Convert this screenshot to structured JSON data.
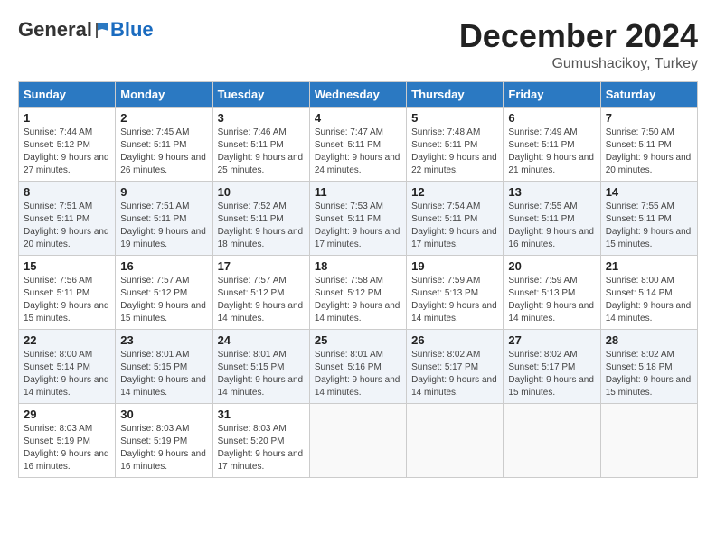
{
  "header": {
    "logo_general": "General",
    "logo_blue": "Blue",
    "month_title": "December 2024",
    "location": "Gumushacikoy, Turkey"
  },
  "weekdays": [
    "Sunday",
    "Monday",
    "Tuesday",
    "Wednesday",
    "Thursday",
    "Friday",
    "Saturday"
  ],
  "weeks": [
    [
      {
        "day": "1",
        "sunrise": "7:44 AM",
        "sunset": "5:12 PM",
        "daylight": "9 hours and 27 minutes."
      },
      {
        "day": "2",
        "sunrise": "7:45 AM",
        "sunset": "5:11 PM",
        "daylight": "9 hours and 26 minutes."
      },
      {
        "day": "3",
        "sunrise": "7:46 AM",
        "sunset": "5:11 PM",
        "daylight": "9 hours and 25 minutes."
      },
      {
        "day": "4",
        "sunrise": "7:47 AM",
        "sunset": "5:11 PM",
        "daylight": "9 hours and 24 minutes."
      },
      {
        "day": "5",
        "sunrise": "7:48 AM",
        "sunset": "5:11 PM",
        "daylight": "9 hours and 22 minutes."
      },
      {
        "day": "6",
        "sunrise": "7:49 AM",
        "sunset": "5:11 PM",
        "daylight": "9 hours and 21 minutes."
      },
      {
        "day": "7",
        "sunrise": "7:50 AM",
        "sunset": "5:11 PM",
        "daylight": "9 hours and 20 minutes."
      }
    ],
    [
      {
        "day": "8",
        "sunrise": "7:51 AM",
        "sunset": "5:11 PM",
        "daylight": "9 hours and 20 minutes."
      },
      {
        "day": "9",
        "sunrise": "7:51 AM",
        "sunset": "5:11 PM",
        "daylight": "9 hours and 19 minutes."
      },
      {
        "day": "10",
        "sunrise": "7:52 AM",
        "sunset": "5:11 PM",
        "daylight": "9 hours and 18 minutes."
      },
      {
        "day": "11",
        "sunrise": "7:53 AM",
        "sunset": "5:11 PM",
        "daylight": "9 hours and 17 minutes."
      },
      {
        "day": "12",
        "sunrise": "7:54 AM",
        "sunset": "5:11 PM",
        "daylight": "9 hours and 17 minutes."
      },
      {
        "day": "13",
        "sunrise": "7:55 AM",
        "sunset": "5:11 PM",
        "daylight": "9 hours and 16 minutes."
      },
      {
        "day": "14",
        "sunrise": "7:55 AM",
        "sunset": "5:11 PM",
        "daylight": "9 hours and 15 minutes."
      }
    ],
    [
      {
        "day": "15",
        "sunrise": "7:56 AM",
        "sunset": "5:11 PM",
        "daylight": "9 hours and 15 minutes."
      },
      {
        "day": "16",
        "sunrise": "7:57 AM",
        "sunset": "5:12 PM",
        "daylight": "9 hours and 15 minutes."
      },
      {
        "day": "17",
        "sunrise": "7:57 AM",
        "sunset": "5:12 PM",
        "daylight": "9 hours and 14 minutes."
      },
      {
        "day": "18",
        "sunrise": "7:58 AM",
        "sunset": "5:12 PM",
        "daylight": "9 hours and 14 minutes."
      },
      {
        "day": "19",
        "sunrise": "7:59 AM",
        "sunset": "5:13 PM",
        "daylight": "9 hours and 14 minutes."
      },
      {
        "day": "20",
        "sunrise": "7:59 AM",
        "sunset": "5:13 PM",
        "daylight": "9 hours and 14 minutes."
      },
      {
        "day": "21",
        "sunrise": "8:00 AM",
        "sunset": "5:14 PM",
        "daylight": "9 hours and 14 minutes."
      }
    ],
    [
      {
        "day": "22",
        "sunrise": "8:00 AM",
        "sunset": "5:14 PM",
        "daylight": "9 hours and 14 minutes."
      },
      {
        "day": "23",
        "sunrise": "8:01 AM",
        "sunset": "5:15 PM",
        "daylight": "9 hours and 14 minutes."
      },
      {
        "day": "24",
        "sunrise": "8:01 AM",
        "sunset": "5:15 PM",
        "daylight": "9 hours and 14 minutes."
      },
      {
        "day": "25",
        "sunrise": "8:01 AM",
        "sunset": "5:16 PM",
        "daylight": "9 hours and 14 minutes."
      },
      {
        "day": "26",
        "sunrise": "8:02 AM",
        "sunset": "5:17 PM",
        "daylight": "9 hours and 14 minutes."
      },
      {
        "day": "27",
        "sunrise": "8:02 AM",
        "sunset": "5:17 PM",
        "daylight": "9 hours and 15 minutes."
      },
      {
        "day": "28",
        "sunrise": "8:02 AM",
        "sunset": "5:18 PM",
        "daylight": "9 hours and 15 minutes."
      }
    ],
    [
      {
        "day": "29",
        "sunrise": "8:03 AM",
        "sunset": "5:19 PM",
        "daylight": "9 hours and 16 minutes."
      },
      {
        "day": "30",
        "sunrise": "8:03 AM",
        "sunset": "5:19 PM",
        "daylight": "9 hours and 16 minutes."
      },
      {
        "day": "31",
        "sunrise": "8:03 AM",
        "sunset": "5:20 PM",
        "daylight": "9 hours and 17 minutes."
      },
      null,
      null,
      null,
      null
    ]
  ]
}
